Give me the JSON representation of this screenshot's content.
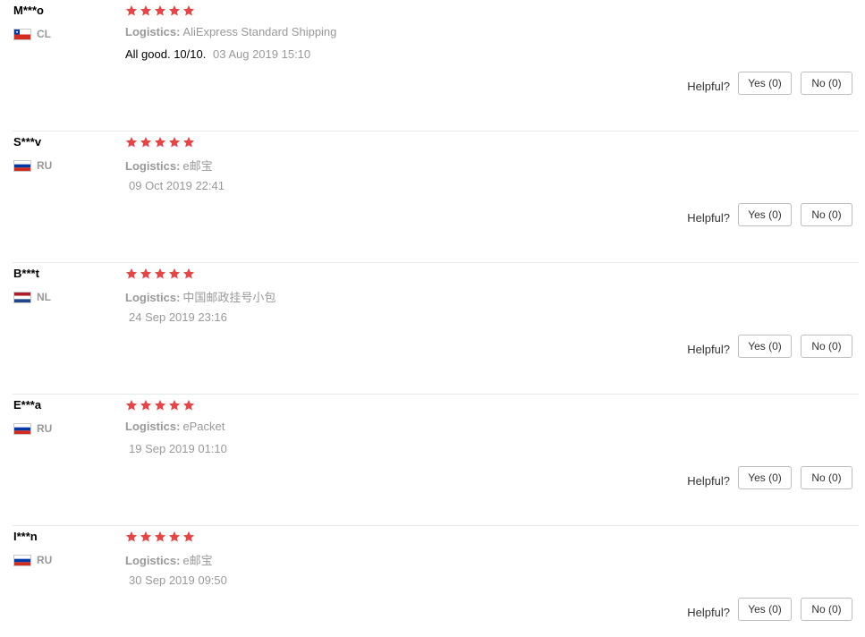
{
  "reviews": [
    {
      "user": "M***o",
      "country": "CL",
      "flag": "chile-flag",
      "rating": 5,
      "logistics_label": "Logistics:",
      "logistics": "AliExpress Standard Shipping",
      "comment": "All good. 10/10.",
      "date": "03 Aug 2019 15:10",
      "helpful_label": "Helpful?",
      "yes_label": "Yes (0)",
      "no_label": "No (0)"
    },
    {
      "user": "S***v",
      "country": "RU",
      "flag": "russia-flag",
      "rating": 5,
      "logistics_label": "Logistics:",
      "logistics": "e邮宝",
      "comment": "",
      "date": "09 Oct 2019 22:41",
      "helpful_label": "Helpful?",
      "yes_label": "Yes (0)",
      "no_label": "No (0)"
    },
    {
      "user": "B***t",
      "country": "NL",
      "flag": "netherlands-flag",
      "rating": 5,
      "logistics_label": "Logistics:",
      "logistics": "中国邮政挂号小包",
      "comment": "",
      "date": "24 Sep 2019 23:16",
      "helpful_label": "Helpful?",
      "yes_label": "Yes (0)",
      "no_label": "No (0)"
    },
    {
      "user": "E***a",
      "country": "RU",
      "flag": "russia-flag",
      "rating": 5,
      "logistics_label": "Logistics:",
      "logistics": "ePacket",
      "comment": "",
      "date": "19 Sep 2019 01:10",
      "helpful_label": "Helpful?",
      "yes_label": "Yes (0)",
      "no_label": "No (0)"
    },
    {
      "user": "I***n",
      "country": "RU",
      "flag": "russia-flag",
      "rating": 5,
      "logistics_label": "Logistics:",
      "logistics": "e邮宝",
      "comment": "",
      "date": "30 Sep 2019 09:50",
      "helpful_label": "Helpful?",
      "yes_label": "Yes (0)",
      "no_label": "No (0)"
    }
  ],
  "colors": {
    "star": "#e64545",
    "muted_text": "#999999",
    "divider": "#e8e8e8",
    "button_border": "#bdbdbd"
  }
}
